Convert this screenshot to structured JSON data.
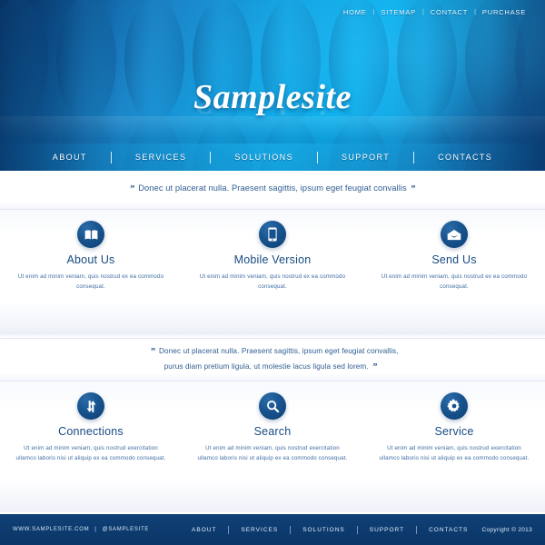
{
  "header": {
    "top_nav": [
      {
        "label": "HOME"
      },
      {
        "label": "SITEMAP"
      },
      {
        "label": "CONTACT"
      },
      {
        "label": "PURCHASE"
      }
    ],
    "separator": "|",
    "logo": "Samplesite",
    "main_nav": [
      {
        "label": "ABOUT"
      },
      {
        "label": "SERVICES"
      },
      {
        "label": "SOLUTIONS"
      },
      {
        "label": "SUPPORT"
      },
      {
        "label": "CONTACTS"
      }
    ],
    "colors": {
      "gradient_dark": "#0b3d77",
      "gradient_light": "#0fb2ee",
      "nav_text": "#ffffff"
    }
  },
  "quote_one": {
    "open_mark": "”",
    "close_mark": "”",
    "text": "Donec ut placerat nulla. Praesent sagittis, ipsum eget feugiat convallis"
  },
  "quote_two": {
    "open_mark": "”",
    "close_mark": "”",
    "line1": "Donec ut placerat nulla. Praesent sagittis, ipsum eget feugiat convallis,",
    "line2": "purus diam pretium ligula, ut molestie lacus ligula sed lorem."
  },
  "features_row1": [
    {
      "icon": "open-book-icon",
      "title": "About Us",
      "desc": "Ut enim ad minim veniam, quis nostrud ex ea commodo consequat."
    },
    {
      "icon": "smartphone-icon",
      "title": "Mobile Version",
      "desc": "Ut enim ad minim veniam, quis nostrud ex ea commodo consequat."
    },
    {
      "icon": "envelope-icon",
      "title": "Send Us",
      "desc": "Ut enim ad minim veniam, quis nostrud ex ea commodo consequat."
    }
  ],
  "features_row2": [
    {
      "icon": "arrows-updown-icon",
      "title": "Connections",
      "desc": "Ut enim ad minim veniam, quis nostrud exercitation ullamco laboris nisi ut aliquip ex ea commodo consequat."
    },
    {
      "icon": "magnifier-icon",
      "title": "Search",
      "desc": "Ut enim ad minim veniam, quis nostrud exercitation ullamco laboris nisi ut aliquip ex ea commodo consequat."
    },
    {
      "icon": "gear-icon",
      "title": "Service",
      "desc": "Ut enim ad minim veniam, quis nostrud exercitation ullamco laboris nisi ut aliquip ex ea commodo consequat."
    }
  ],
  "footer": {
    "website": "WWW.SAMPLESITE.COM",
    "separator": "|",
    "social": "@SAMPLESITE",
    "nav": [
      {
        "label": "ABOUT"
      },
      {
        "label": "SERVICES"
      },
      {
        "label": "SOLUTIONS"
      },
      {
        "label": "SUPPORT"
      },
      {
        "label": "CONTACTS"
      }
    ],
    "copyright": "Copyright © 2013",
    "background": "#0b3668"
  },
  "theme": {
    "icon_circle": "#14528d",
    "title_color": "#174b81",
    "body_color": "#3f6ea3"
  }
}
